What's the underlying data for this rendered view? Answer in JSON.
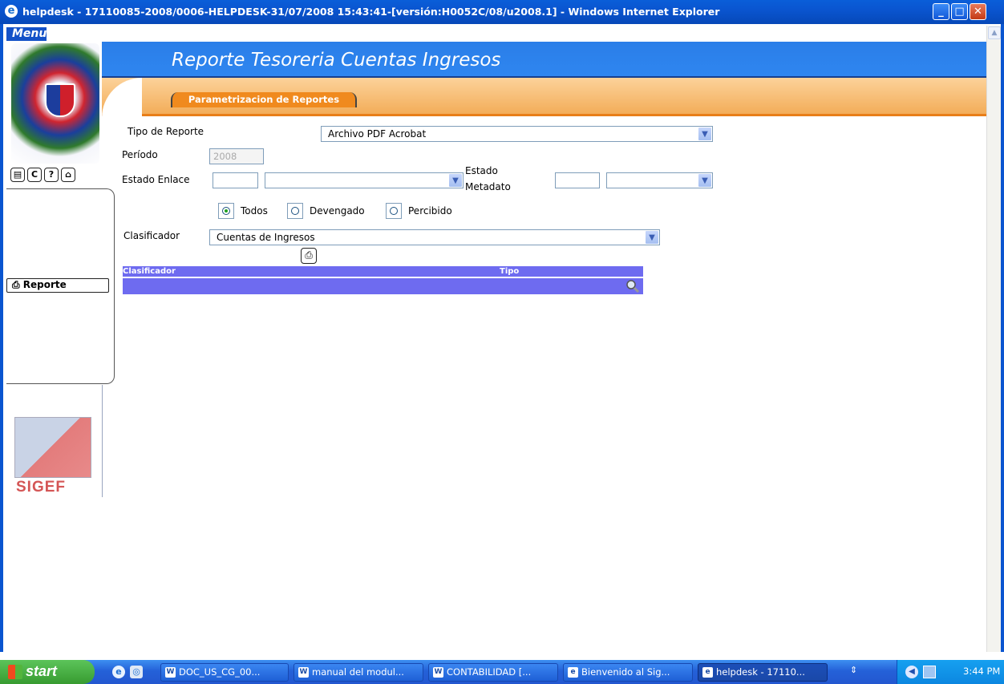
{
  "window": {
    "title": "helpdesk - 17110085-2008/0006-HELPDESK-31/07/2008 15:43:41-[versión:H0052C/08/u2008.1] - Windows Internet Explorer",
    "buttons": {
      "minimize": "_",
      "maximize": "□",
      "close": "✕"
    }
  },
  "sidebar": {
    "menu_label": "Menu",
    "icons": [
      {
        "name": "document-icon",
        "glyph": "▤"
      },
      {
        "name": "refresh-icon",
        "glyph": "C"
      },
      {
        "name": "help-icon",
        "glyph": "?"
      },
      {
        "name": "home-icon",
        "glyph": "⌂"
      }
    ],
    "report_button": "Reporte",
    "logo_text": "SIGEF"
  },
  "header": {
    "title": "Reporte Tesoreria Cuentas Ingresos",
    "tab": "Parametrizacion de Reportes"
  },
  "form": {
    "tipo_reporte": {
      "label": "Tipo de Reporte",
      "value": "Archivo PDF Acrobat"
    },
    "periodo": {
      "label": "Período",
      "value": "2008"
    },
    "estado_enlace": {
      "label": "Estado Enlace",
      "code": "",
      "value": ""
    },
    "estado_metadato": {
      "label_line1": "Estado",
      "label_line2": "Metadato",
      "code": "",
      "value": ""
    },
    "radios": [
      {
        "label": "Todos",
        "checked": true
      },
      {
        "label": "Devengado",
        "checked": false
      },
      {
        "label": "Percibido",
        "checked": false
      }
    ],
    "clasificador": {
      "label": "Clasificador",
      "value": "Cuentas de Ingresos"
    }
  },
  "table": {
    "columns": [
      "Clasificador",
      "Tipo"
    ]
  },
  "taskbar": {
    "start": "start",
    "tasks": [
      {
        "label": "DOC_US_CG_00...",
        "icon": "W"
      },
      {
        "label": "manual del modul...",
        "icon": "W"
      },
      {
        "label": "CONTABILIDAD [...",
        "icon": "W"
      },
      {
        "label": "Bienvenido al Sig...",
        "icon": "e"
      },
      {
        "label": "helpdesk - 17110...",
        "icon": "e"
      }
    ],
    "clock": "3:44 PM"
  },
  "colors": {
    "header_blue": "#2f86f0",
    "tab_orange": "#f08a1e",
    "table_purple": "#6e6bf0",
    "xp_blue": "#0a55d0"
  }
}
